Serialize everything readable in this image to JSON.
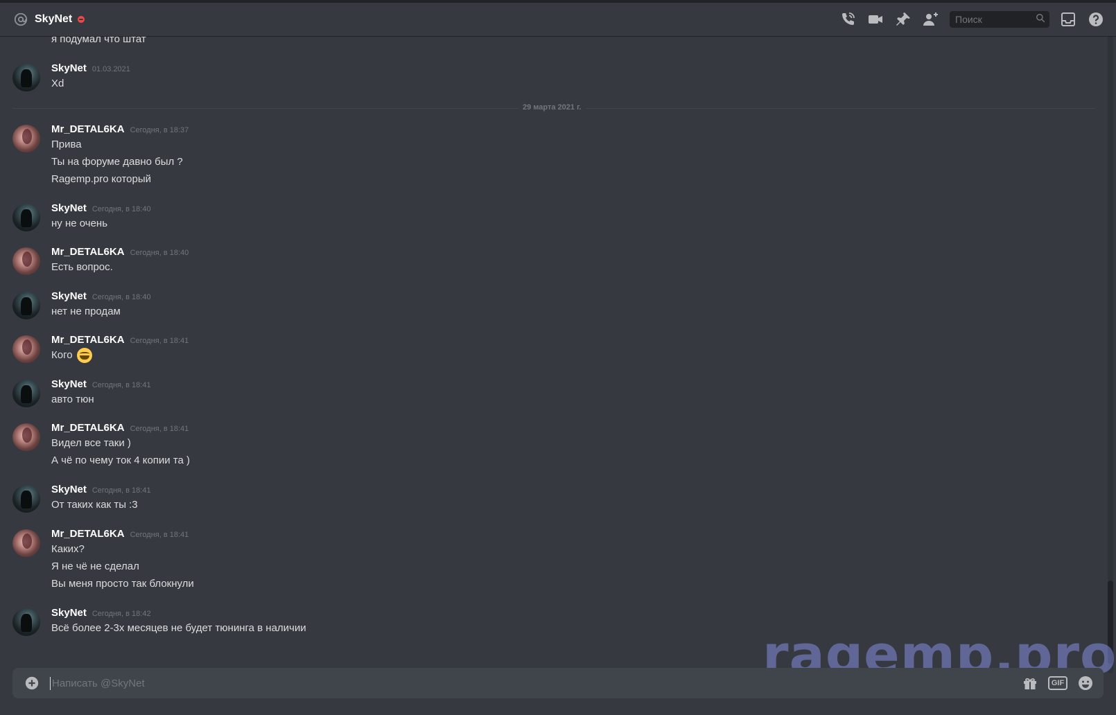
{
  "header": {
    "channel_name": "SkyNet",
    "search_placeholder": "Поиск"
  },
  "messages": {
    "partial_line": "я подумал что штат",
    "date_divider": "29 марта 2021 г.",
    "groups": [
      {
        "author": "SkyNet",
        "timestamp": "01.03.2021",
        "lines": [
          "Xd"
        ]
      },
      {
        "author": "Mr_DETAL6KA",
        "timestamp": "Сегодня, в 18:37",
        "lines": [
          "Прива",
          "Ты на форуме давно был ?",
          "Ragemp.pro который"
        ]
      },
      {
        "author": "SkyNet",
        "timestamp": "Сегодня, в 18:40",
        "lines": [
          "ну не очень"
        ]
      },
      {
        "author": "Mr_DETAL6KA",
        "timestamp": "Сегодня, в 18:40",
        "lines": [
          "Есть вопрос."
        ]
      },
      {
        "author": "SkyNet",
        "timestamp": "Сегодня, в 18:40",
        "lines": [
          "нет не продам"
        ]
      },
      {
        "author": "Mr_DETAL6KA",
        "timestamp": "Сегодня, в 18:41",
        "lines": [
          "Кого"
        ]
      },
      {
        "author": "SkyNet",
        "timestamp": "Сегодня, в 18:41",
        "lines": [
          "авто тюн"
        ]
      },
      {
        "author": "Mr_DETAL6KA",
        "timestamp": "Сегодня, в 18:41",
        "lines": [
          "Видел все таки )",
          "А чё по чему ток 4 копии та )"
        ]
      },
      {
        "author": "SkyNet",
        "timestamp": "Сегодня, в 18:41",
        "lines": [
          "От таких как ты :3"
        ]
      },
      {
        "author": "Mr_DETAL6KA",
        "timestamp": "Сегодня, в 18:41",
        "lines": [
          "Каких?",
          "Я не чё не сделал",
          "Вы меня просто так блокнули"
        ]
      },
      {
        "author": "SkyNet",
        "timestamp": "Сегодня, в 18:42",
        "lines": [
          "Всё более 2-3х месяцев не будет тюнинга в наличии"
        ]
      }
    ]
  },
  "composer": {
    "placeholder": "Написать @SkyNet",
    "gif_label": "GIF"
  },
  "watermark": "ragemp.pro",
  "icons": {
    "mention": "at-icon",
    "status": "dnd-status-icon",
    "call": "phone-icon",
    "video": "video-camera-icon",
    "pin": "pin-icon",
    "add_friend": "add-user-icon",
    "search": "search-icon",
    "inbox": "inbox-icon",
    "help": "help-icon",
    "attach": "plus-circle-icon",
    "gift": "gift-icon",
    "emoji": "emoji-icon"
  }
}
